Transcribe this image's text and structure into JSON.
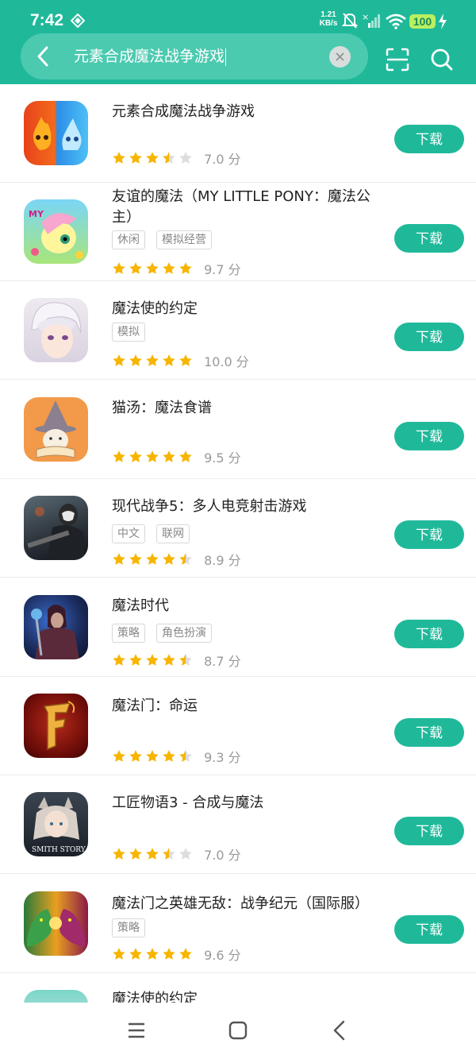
{
  "status_bar": {
    "time": "7:42",
    "net_speed_value": "1.21",
    "net_speed_unit": "KB/s",
    "battery": "100"
  },
  "search": {
    "query": "元素合成魔法战争游戏"
  },
  "colors": {
    "accent": "#1fb99a",
    "star": "#f7b500",
    "star_empty": "#dddddd"
  },
  "apps": [
    {
      "name": "元素合成魔法战争游戏",
      "tags": [],
      "stars": 3.5,
      "score": "7.0 分",
      "button": "下载",
      "icon": "fire-water-icon"
    },
    {
      "name": "友谊的魔法（MY LITTLE PONY：魔法公主）",
      "tags": [
        "休闲",
        "模拟经营"
      ],
      "stars": 5,
      "score": "9.7 分",
      "button": "下载",
      "icon": "pony-icon"
    },
    {
      "name": "魔法使的约定",
      "tags": [
        "模拟"
      ],
      "stars": 5,
      "score": "10.0 分",
      "button": "下载",
      "icon": "anime-boy-icon"
    },
    {
      "name": "猫汤：魔法食谱",
      "tags": [],
      "stars": 5,
      "score": "9.5 分",
      "button": "下载",
      "icon": "cat-wizard-icon"
    },
    {
      "name": "现代战争5：多人电竞射击游戏",
      "tags": [
        "中文",
        "联网"
      ],
      "stars": 4.5,
      "score": "8.9 分",
      "button": "下载",
      "icon": "soldier-icon"
    },
    {
      "name": "魔法时代",
      "tags": [
        "策略",
        "角色扮演"
      ],
      "stars": 4.5,
      "score": "8.7 分",
      "button": "下载",
      "icon": "mage-icon"
    },
    {
      "name": "魔法门：命运",
      "tags": [],
      "stars": 4.5,
      "score": "9.3 分",
      "button": "下载",
      "icon": "dragon-f-icon"
    },
    {
      "name": "工匠物语3 - 合成与魔法",
      "tags": [],
      "stars": 3.5,
      "score": "7.0 分",
      "button": "下载",
      "icon": "smith-girl-icon"
    },
    {
      "name": "魔法门之英雄无敌：战争纪元（国际服）",
      "tags": [
        "策略"
      ],
      "stars": 5,
      "score": "9.6 分",
      "button": "下载",
      "icon": "dragons-icon"
    },
    {
      "name": "魔法使的约定",
      "tags": [],
      "stars": 0,
      "score": "",
      "button": "",
      "icon": "anime-boy-icon"
    }
  ]
}
